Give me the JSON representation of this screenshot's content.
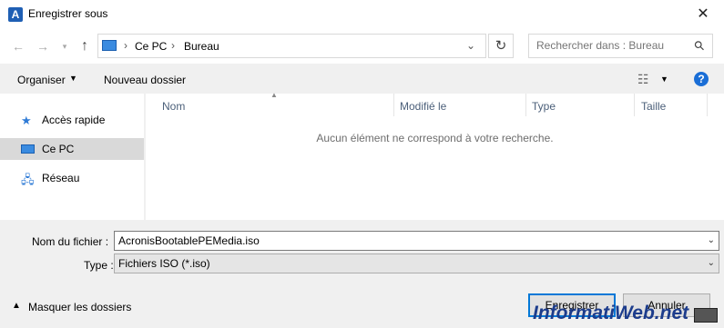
{
  "window": {
    "title": "Enregistrer sous",
    "app_icon_letter": "A"
  },
  "address": {
    "crumbs": [
      "Ce PC",
      "Bureau"
    ]
  },
  "search": {
    "placeholder": "Rechercher dans : Bureau"
  },
  "toolbar": {
    "organise_label": "Organiser",
    "new_folder_label": "Nouveau dossier"
  },
  "nav": {
    "items": [
      {
        "label": "Accès rapide",
        "icon": "star-icon"
      },
      {
        "label": "Ce PC",
        "icon": "computer-icon",
        "selected": true
      },
      {
        "label": "Réseau",
        "icon": "network-icon"
      }
    ]
  },
  "list": {
    "columns": [
      "Nom",
      "Modifié le",
      "Type",
      "Taille"
    ],
    "empty_message": "Aucun élément ne correspond à votre recherche."
  },
  "form": {
    "filename_label": "Nom du fichier :",
    "filename_value": "AcronisBootablePEMedia.iso",
    "type_label": "Type :",
    "type_value": "Fichiers ISO (*.iso)"
  },
  "footer": {
    "hide_folders_label": "Masquer les dossiers",
    "save_label": "Enregistrer",
    "cancel_label": "Annuler"
  },
  "watermark": {
    "text": "InformatiWeb.net"
  },
  "colors": {
    "accent": "#0078d7",
    "selected_nav": "#d9d9d9",
    "help": "#1a6ed6"
  }
}
